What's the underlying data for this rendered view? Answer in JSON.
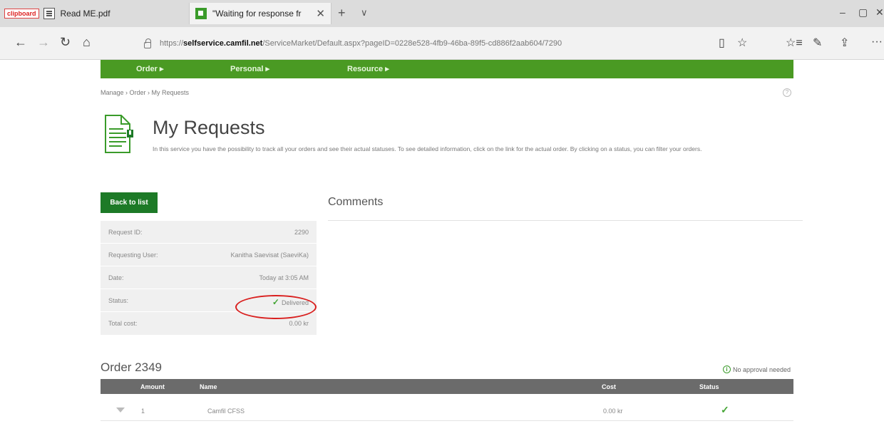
{
  "browser": {
    "tabs": [
      {
        "badge": "clipboard",
        "label": "Read ME.pdf"
      },
      {
        "label": "\"Waiting for response fr"
      }
    ],
    "new_tab": "+",
    "tab_menu": "∨",
    "window": {
      "minimize": "–",
      "maximize": "▢",
      "close": "✕"
    },
    "nav": {
      "back": "←",
      "forward": "→",
      "refresh": "↻",
      "home": "⌂"
    },
    "url": {
      "prefix": "https://",
      "domain": "selfservice.camfil.net",
      "path": "/ServiceMarket/Default.aspx?pageID=0228e528-4fb9-46ba-89f5-cd886f2aab604/7290"
    },
    "toolbar_icons": {
      "reading": "▯",
      "favorite": "☆",
      "favorites": "☆≡",
      "pen": "✎",
      "share": "⇪",
      "more": "···"
    }
  },
  "menu": {
    "order": "Order ▸",
    "personal": "Personal ▸",
    "resource": "Resource ▸"
  },
  "breadcrumb": "Manage › Order › My Requests",
  "help": "?",
  "page": {
    "title": "My Requests",
    "description": "In this service you have the possibility to track all your orders and see their actual statuses. To see detailed information, click on the link for the actual order. By clicking on a status, you can filter your orders."
  },
  "back_button": "Back to list",
  "details": {
    "request_id_label": "Request ID:",
    "request_id": "2290",
    "requesting_user_label": "Requesting User:",
    "requesting_user": "Kanitha Saevisat (SaeviKa)",
    "date_label": "Date:",
    "date": "Today at 3:05 AM",
    "status_label": "Status:",
    "status_check": "✓",
    "status": "Delivered",
    "total_cost_label": "Total cost:",
    "total_cost": "0.00 kr"
  },
  "comments_title": "Comments",
  "order": {
    "title": "Order 2349",
    "approval_icon": "i",
    "approval": "No approval needed",
    "columns": {
      "amount": "Amount",
      "name": "Name",
      "cost": "Cost",
      "status": "Status"
    },
    "rows": [
      {
        "amount": "1",
        "name": "Camfil CFSS",
        "cost": "0.00 kr",
        "status": "✓"
      }
    ]
  },
  "colors": {
    "brand_green": "#4a9a23",
    "button_green": "#1d7a27",
    "status_green": "#45a536",
    "highlight_red": "#d9201f"
  }
}
